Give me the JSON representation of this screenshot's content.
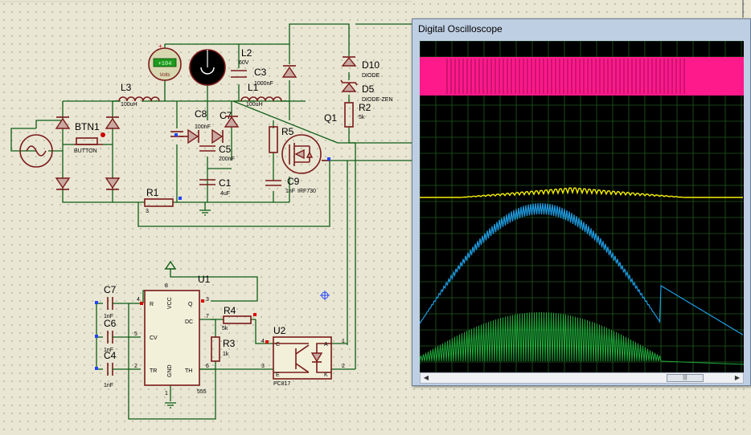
{
  "colors": {
    "wire": "#0d5e16",
    "component": "#7b1a1a",
    "trace_magenta": "#ff1a8c",
    "trace_yellow": "#f5f000",
    "trace_blue": "#1e9be0",
    "trace_green": "#1faa3a",
    "grid": "#1e5a1e"
  },
  "schematic": {
    "labels": {
      "l3": "L3",
      "l3_val": "100uH",
      "btn1": "BTN1",
      "btn1_type": "BUTTON",
      "c8": "C8",
      "c8_val": "100nF",
      "c7_top": "C7",
      "c5": "C5",
      "c5_val": "200nF",
      "c1": "C1",
      "c1_val": "4uF",
      "r1": "R1",
      "r1_pin": "3",
      "l2": "L2",
      "l2_val": "60V",
      "c3": "C3",
      "c3_val": "1000nF",
      "l1": "L1",
      "l1_val": "100uH",
      "r5": "R5",
      "c9": "C9",
      "c9_val": "1nF",
      "q1_part": "IRF730",
      "d10": "D10",
      "d10_type": "DIODE",
      "d5": "D5",
      "d5_type": "DIODE-ZEN",
      "r2": "R2",
      "r2_val": "5k",
      "q1": "Q1",
      "voltmeter_value": "+104",
      "voltmeter_unit": "Volts",
      "u1": "U1",
      "u1_part": "555",
      "u1_r": "R",
      "u1_vcc": "VCC",
      "u1_q": "Q",
      "u1_dc": "DC",
      "u1_cv": "CV",
      "u1_tr": "TR",
      "u1_gnd": "GND",
      "u1_th": "TH",
      "pin4": "4",
      "pin8": "8",
      "pin3": "3",
      "pin7": "7",
      "pin5": "5",
      "pin2": "2",
      "pin1": "1",
      "pin6": "6",
      "c7": "C7",
      "c7_val": "1nF",
      "c6": "C6",
      "c6_val": "1nF",
      "c4": "C4",
      "c4_val": "1nF",
      "r4": "R4",
      "r4_val": "5k",
      "r3": "R3",
      "r3_val": "1k",
      "u2": "U2",
      "u2_part": "PC817",
      "u2_c": "C",
      "u2_e": "E",
      "u2_a": "A",
      "u2_k": "K",
      "u2_p4": "4",
      "u2_p3": "3",
      "u2_p1": "1",
      "u2_p2": "2"
    }
  },
  "oscilloscope": {
    "title": "Digital Oscilloscope",
    "scrollbar": {
      "left_arrow": "◀",
      "right_arrow": "▶",
      "thumb": "|||"
    }
  }
}
